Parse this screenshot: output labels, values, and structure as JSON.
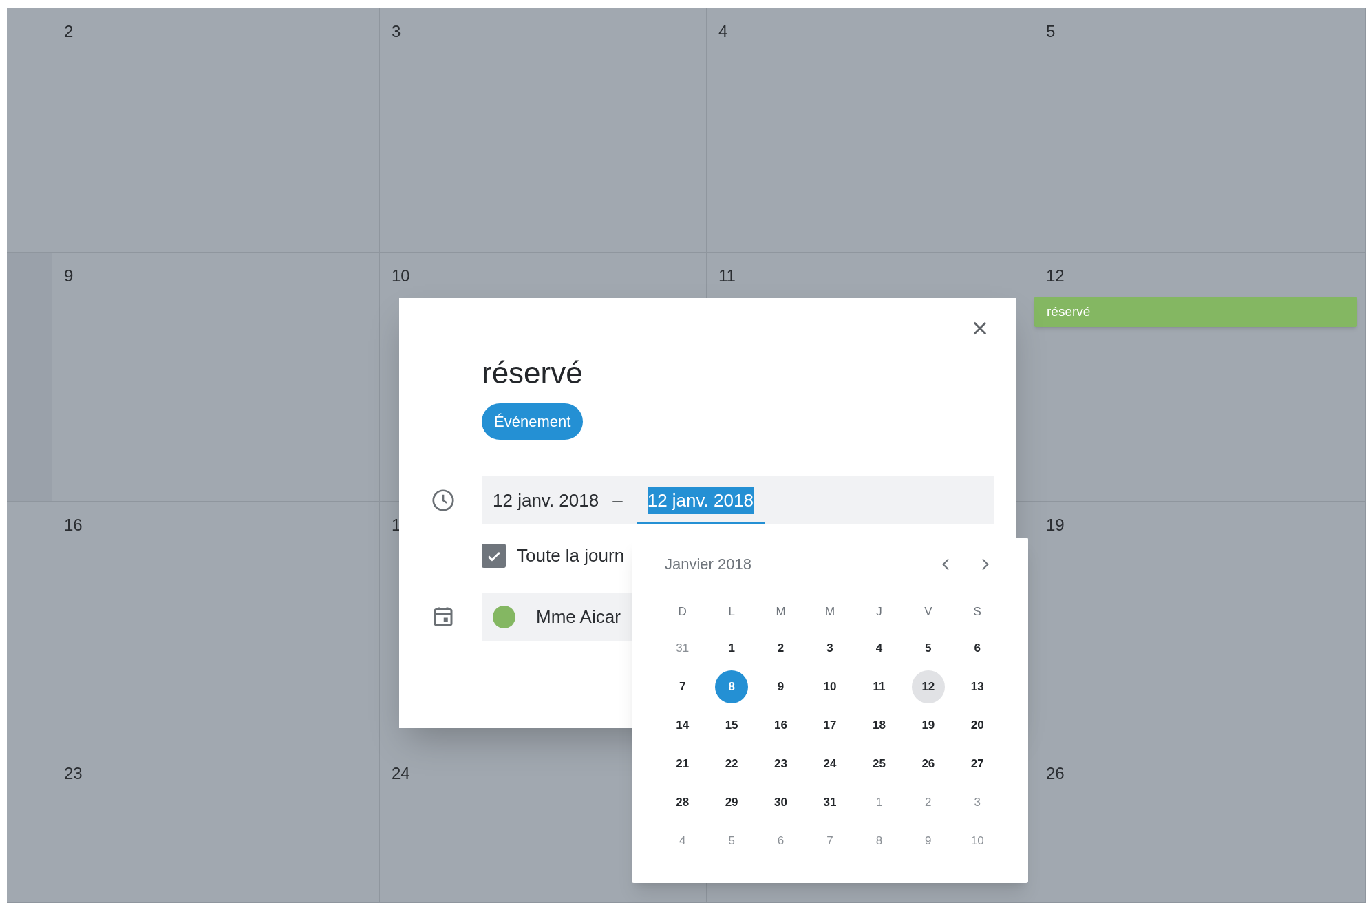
{
  "calendar": {
    "columns": [
      {
        "days": [
          {
            "label": "2"
          },
          {
            "label": "9"
          },
          {
            "label": "16"
          },
          {
            "label": "23"
          }
        ]
      },
      {
        "days": [
          {
            "label": "3"
          },
          {
            "label": "10"
          },
          {
            "label": "1"
          },
          {
            "label": "24"
          }
        ]
      },
      {
        "days": [
          {
            "label": "4"
          },
          {
            "label": "11"
          }
        ]
      },
      {
        "days": [
          {
            "label": "5"
          },
          {
            "label": "12",
            "events": [
              {
                "title": "réservé",
                "color": "#84b762"
              }
            ]
          },
          {
            "label": "19"
          },
          {
            "label": "26"
          }
        ]
      }
    ]
  },
  "dialog": {
    "title": "réservé",
    "type_chip": "Événement",
    "date_range": {
      "start": "12 janv. 2018",
      "separator": "–",
      "end": "12 janv. 2018",
      "end_focused": true
    },
    "all_day": {
      "label": "Toute la journ",
      "checked": true
    },
    "calendar_field": {
      "label": "Mme Aicar",
      "color": "#84b762"
    }
  },
  "date_picker": {
    "month": "Janvier 2018",
    "weekdays": [
      "D",
      "L",
      "M",
      "M",
      "J",
      "V",
      "S"
    ],
    "weeks": [
      [
        {
          "label": "31",
          "outside": true,
          "selected": false,
          "current": false
        },
        {
          "label": "1",
          "outside": false,
          "selected": false,
          "current": false
        },
        {
          "label": "2",
          "outside": false,
          "selected": false,
          "current": false
        },
        {
          "label": "3",
          "outside": false,
          "selected": false,
          "current": false
        },
        {
          "label": "4",
          "outside": false,
          "selected": false,
          "current": false
        },
        {
          "label": "5",
          "outside": false,
          "selected": false,
          "current": false
        },
        {
          "label": "6",
          "outside": false,
          "selected": false,
          "current": false
        }
      ],
      [
        {
          "label": "7",
          "outside": false,
          "selected": false,
          "current": false
        },
        {
          "label": "8",
          "outside": false,
          "selected": true,
          "current": false
        },
        {
          "label": "9",
          "outside": false,
          "selected": false,
          "current": false
        },
        {
          "label": "10",
          "outside": false,
          "selected": false,
          "current": false
        },
        {
          "label": "11",
          "outside": false,
          "selected": false,
          "current": false
        },
        {
          "label": "12",
          "outside": false,
          "selected": false,
          "current": true
        },
        {
          "label": "13",
          "outside": false,
          "selected": false,
          "current": false
        }
      ],
      [
        {
          "label": "14",
          "outside": false,
          "selected": false,
          "current": false
        },
        {
          "label": "15",
          "outside": false,
          "selected": false,
          "current": false
        },
        {
          "label": "16",
          "outside": false,
          "selected": false,
          "current": false
        },
        {
          "label": "17",
          "outside": false,
          "selected": false,
          "current": false
        },
        {
          "label": "18",
          "outside": false,
          "selected": false,
          "current": false
        },
        {
          "label": "19",
          "outside": false,
          "selected": false,
          "current": false
        },
        {
          "label": "20",
          "outside": false,
          "selected": false,
          "current": false
        }
      ],
      [
        {
          "label": "21",
          "outside": false,
          "selected": false,
          "current": false
        },
        {
          "label": "22",
          "outside": false,
          "selected": false,
          "current": false
        },
        {
          "label": "23",
          "outside": false,
          "selected": false,
          "current": false
        },
        {
          "label": "24",
          "outside": false,
          "selected": false,
          "current": false
        },
        {
          "label": "25",
          "outside": false,
          "selected": false,
          "current": false
        },
        {
          "label": "26",
          "outside": false,
          "selected": false,
          "current": false
        },
        {
          "label": "27",
          "outside": false,
          "selected": false,
          "current": false
        }
      ],
      [
        {
          "label": "28",
          "outside": false,
          "selected": false,
          "current": false
        },
        {
          "label": "29",
          "outside": false,
          "selected": false,
          "current": false
        },
        {
          "label": "30",
          "outside": false,
          "selected": false,
          "current": false
        },
        {
          "label": "31",
          "outside": false,
          "selected": false,
          "current": false
        },
        {
          "label": "1",
          "outside": true,
          "selected": false,
          "current": false
        },
        {
          "label": "2",
          "outside": true,
          "selected": false,
          "current": false
        },
        {
          "label": "3",
          "outside": true,
          "selected": false,
          "current": false
        }
      ],
      [
        {
          "label": "4",
          "outside": true,
          "selected": false,
          "current": false
        },
        {
          "label": "5",
          "outside": true,
          "selected": false,
          "current": false
        },
        {
          "label": "6",
          "outside": true,
          "selected": false,
          "current": false
        },
        {
          "label": "7",
          "outside": true,
          "selected": false,
          "current": false
        },
        {
          "label": "8",
          "outside": true,
          "selected": false,
          "current": false
        },
        {
          "label": "9",
          "outside": true,
          "selected": false,
          "current": false
        },
        {
          "label": "10",
          "outside": true,
          "selected": false,
          "current": false
        }
      ]
    ]
  }
}
